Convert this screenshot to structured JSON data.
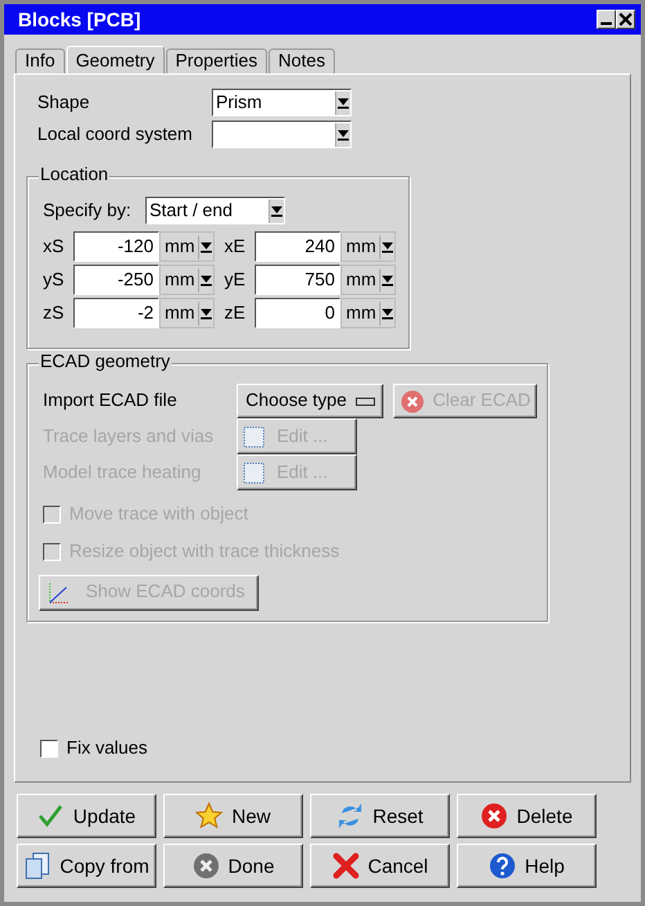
{
  "window": {
    "title": "Blocks [PCB]"
  },
  "tabs": [
    {
      "label": "Info",
      "selected": false
    },
    {
      "label": "Geometry",
      "selected": true
    },
    {
      "label": "Properties",
      "selected": false
    },
    {
      "label": "Notes",
      "selected": false
    }
  ],
  "shape": {
    "label": "Shape",
    "value": "Prism"
  },
  "local_coord": {
    "label": "Local coord system"
  },
  "location": {
    "title": "Location",
    "specify_label": "Specify by:",
    "specify_value": "Start / end",
    "fields": [
      {
        "label": "xS",
        "value": "-120",
        "unit": "mm"
      },
      {
        "label": "xE",
        "value": "240",
        "unit": "mm"
      },
      {
        "label": "yS",
        "value": "-250",
        "unit": "mm"
      },
      {
        "label": "yE",
        "value": "750",
        "unit": "mm"
      },
      {
        "label": "zS",
        "value": "-2",
        "unit": "mm"
      },
      {
        "label": "zE",
        "value": "0",
        "unit": "mm"
      }
    ]
  },
  "ecad": {
    "title": "ECAD geometry",
    "import_label": "Import ECAD file",
    "choose_button": "Choose type",
    "clear_button": {
      "label": "Clear ECAD",
      "disabled": true
    },
    "edit_rows": [
      {
        "label": "Trace layers and vias",
        "button": "Edit ...",
        "disabled": true
      },
      {
        "label": "Model trace heating",
        "button": "Edit ...",
        "disabled": true
      }
    ],
    "checkboxes": [
      {
        "label": "Move trace with object",
        "checked": false,
        "disabled": true
      },
      {
        "label": "Resize object with trace thickness",
        "checked": false,
        "disabled": true
      }
    ],
    "coords_button": {
      "label": "Show ECAD coords",
      "disabled": true
    }
  },
  "fix_values": {
    "label": "Fix values",
    "checked": false
  },
  "buttons": [
    {
      "label": "Update",
      "kind": "check"
    },
    {
      "label": "New",
      "kind": "star"
    },
    {
      "label": "Reset",
      "kind": "reset"
    },
    {
      "label": "Delete",
      "kind": "delete"
    },
    {
      "label": "Copy from",
      "kind": "copy"
    },
    {
      "label": "Done",
      "kind": "done"
    },
    {
      "label": "Cancel",
      "kind": "cancel"
    },
    {
      "label": "Help",
      "kind": "help"
    }
  ]
}
